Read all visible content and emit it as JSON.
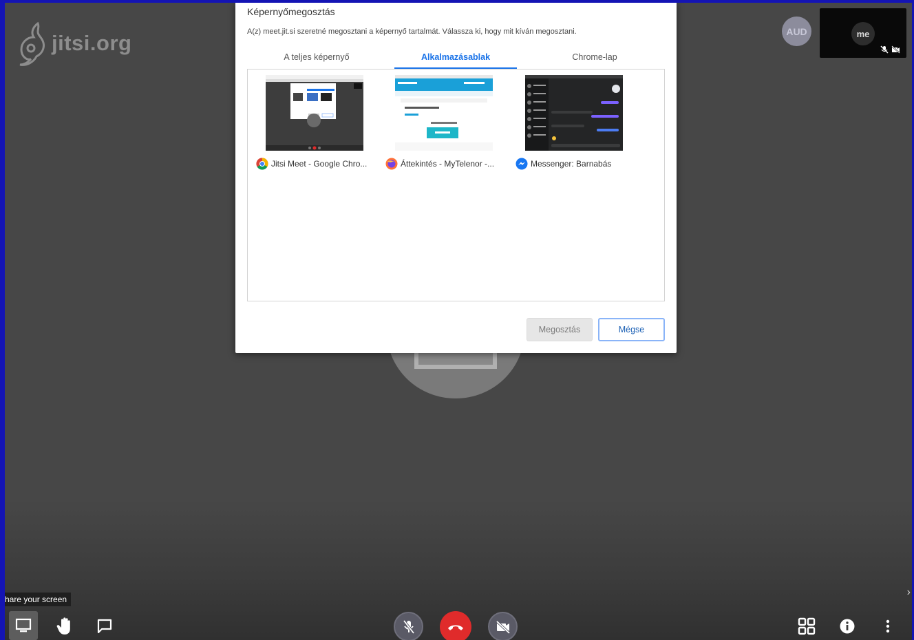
{
  "app": {
    "logo_text": "jitsi.org",
    "aud_avatar": "AUD",
    "local_video_label": "me"
  },
  "dialog": {
    "title": "Képernyőmegosztás",
    "description": "A(z) meet.jit.si szeretné megosztani a képernyő tartalmát. Válassza ki, hogy mit kíván megosztani.",
    "tabs": [
      {
        "label": "A teljes képernyő",
        "active": false
      },
      {
        "label": "Alkalmazásablak",
        "active": true
      },
      {
        "label": "Chrome-lap",
        "active": false
      }
    ],
    "windows": [
      {
        "label": "Jitsi Meet - Google Chro...",
        "icon": "chrome-icon"
      },
      {
        "label": "Áttekintés - MyTelenor -...",
        "icon": "firefox-icon"
      },
      {
        "label": "Messenger: Barnabás",
        "icon": "messenger-icon"
      }
    ],
    "share_button": "Megosztás",
    "cancel_button": "Mégse"
  },
  "tooltip": {
    "text": "hare your screen"
  },
  "toolbar": {
    "left": [
      "screen-share-icon",
      "raise-hand-icon",
      "chat-icon"
    ],
    "center": [
      "mic-muted-icon",
      "hangup-icon",
      "camera-off-icon"
    ],
    "right": [
      "tile-view-icon",
      "info-icon",
      "more-icon"
    ]
  },
  "colors": {
    "background": "#474747",
    "accent": "#1a73e8",
    "hangup": "#e02b2b",
    "frame": "#1414b4"
  }
}
